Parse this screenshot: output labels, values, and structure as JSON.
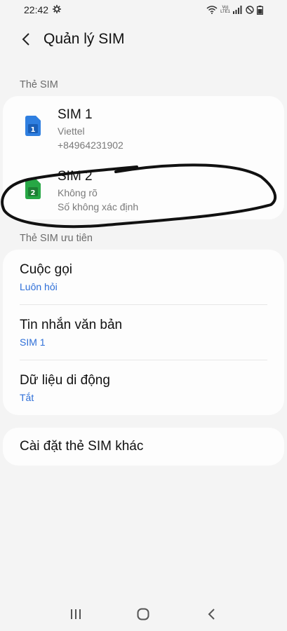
{
  "status_bar": {
    "time": "22:42",
    "network_label_top": "Vo)",
    "network_label_bottom": "LTE1"
  },
  "app_bar": {
    "title": "Quản lý SIM"
  },
  "sim_section": {
    "header": "Thẻ SIM",
    "items": [
      {
        "name": "SIM 1",
        "carrier": "Viettel",
        "number": "+84964231902",
        "badge": "1",
        "color": "#2f7fe0"
      },
      {
        "name": "SIM 2",
        "carrier": "Không rõ",
        "number": "Số không xác định",
        "badge": "2",
        "color": "#27a745"
      }
    ]
  },
  "preferred_section": {
    "header": "Thẻ SIM ưu tiên",
    "items": [
      {
        "title": "Cuộc gọi",
        "value": "Luôn hỏi"
      },
      {
        "title": "Tin nhắn văn bản",
        "value": "SIM 1"
      },
      {
        "title": "Dữ liệu di động",
        "value": "Tắt"
      }
    ]
  },
  "other": {
    "title": "Cài đặt thẻ SIM khác"
  },
  "colors": {
    "accent_blue": "#2e6fd8",
    "background": "#f4f4f4",
    "card": "#fdfdfd"
  }
}
